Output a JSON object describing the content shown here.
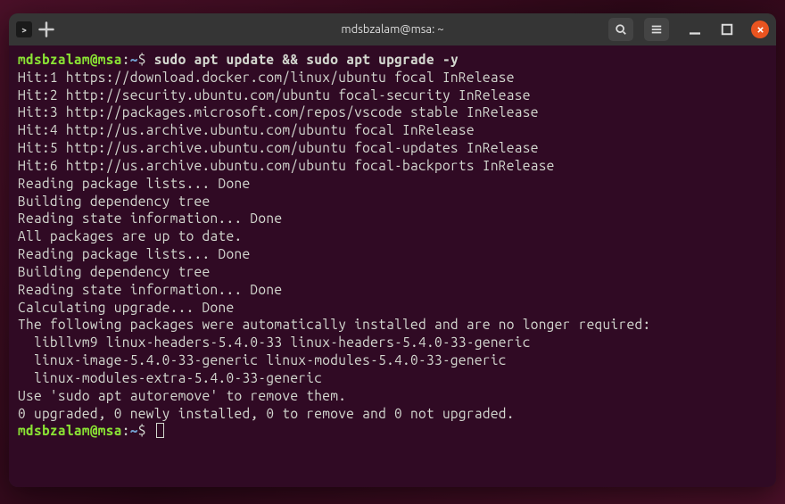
{
  "titlebar": {
    "title": "mdsbzalam@msa: ~"
  },
  "prompt": {
    "user_host": "mdsbzalam@msa",
    "path": "~",
    "symbol": "$"
  },
  "command": "sudo apt update && sudo apt upgrade -y",
  "output_lines": [
    "Hit:1 https://download.docker.com/linux/ubuntu focal InRelease",
    "Hit:2 http://security.ubuntu.com/ubuntu focal-security InRelease",
    "Hit:3 http://packages.microsoft.com/repos/vscode stable InRelease",
    "Hit:4 http://us.archive.ubuntu.com/ubuntu focal InRelease",
    "Hit:5 http://us.archive.ubuntu.com/ubuntu focal-updates InRelease",
    "Hit:6 http://us.archive.ubuntu.com/ubuntu focal-backports InRelease",
    "Reading package lists... Done",
    "Building dependency tree",
    "Reading state information... Done",
    "All packages are up to date.",
    "Reading package lists... Done",
    "Building dependency tree",
    "Reading state information... Done",
    "Calculating upgrade... Done",
    "The following packages were automatically installed and are no longer required:",
    "  libllvm9 linux-headers-5.4.0-33 linux-headers-5.4.0-33-generic",
    "  linux-image-5.4.0-33-generic linux-modules-5.4.0-33-generic",
    "  linux-modules-extra-5.4.0-33-generic",
    "Use 'sudo apt autoremove' to remove them.",
    "0 upgraded, 0 newly installed, 0 to remove and 0 not upgraded."
  ]
}
